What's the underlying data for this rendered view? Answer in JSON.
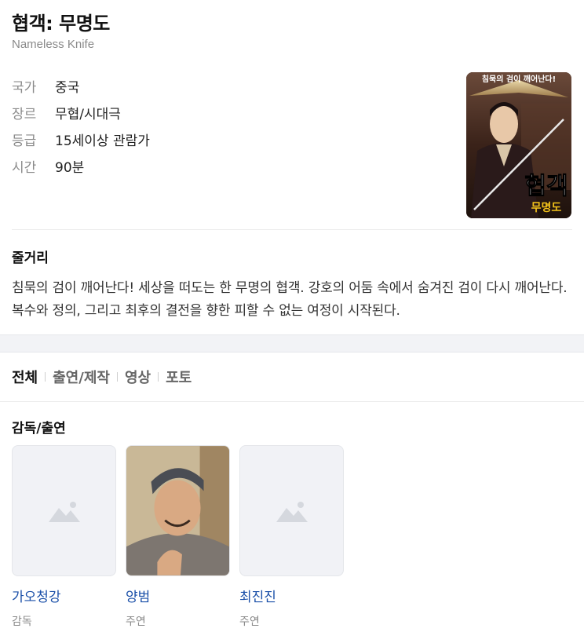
{
  "movie": {
    "title": "협객: 무명도",
    "subtitle": "Nameless Knife",
    "info": [
      {
        "key": "국가",
        "value": "중국"
      },
      {
        "key": "장르",
        "value": "무협/시대극"
      },
      {
        "key": "등급",
        "value": "15세이상 관람가"
      },
      {
        "key": "시간",
        "value": "90분"
      }
    ],
    "poster": {
      "tagline": "침묵의 검이 깨어난다!",
      "title_big": "협객",
      "title_small": "무명도"
    }
  },
  "synopsis": {
    "heading": "줄거리",
    "text": "침묵의 검이 깨어난다! 세상을 떠도는 한 무명의 협객. 강호의 어둠 속에서 숨겨진 검이 다시 깨어난다.복수와 정의, 그리고 최후의 결전을 향한 피할 수 없는 여정이 시작된다."
  },
  "tabs": [
    {
      "label": "전체",
      "active": true
    },
    {
      "label": "출연/제작",
      "active": false
    },
    {
      "label": "영상",
      "active": false
    },
    {
      "label": "포토",
      "active": false
    }
  ],
  "cast_section": {
    "heading": "감독/출연",
    "people": [
      {
        "name": "가오청강",
        "role": "감독",
        "photo": "placeholder-image-icon"
      },
      {
        "name": "양범",
        "role": "주연",
        "photo": "portrait"
      },
      {
        "name": "최진진",
        "role": "주연",
        "photo": "placeholder-image-icon"
      }
    ]
  },
  "colors": {
    "link": "#1a4fa8",
    "muted": "#8a8a8a",
    "band": "#f2f3f6",
    "poster_title": "#ffffff",
    "poster_subtitle": "#f2c21a"
  }
}
